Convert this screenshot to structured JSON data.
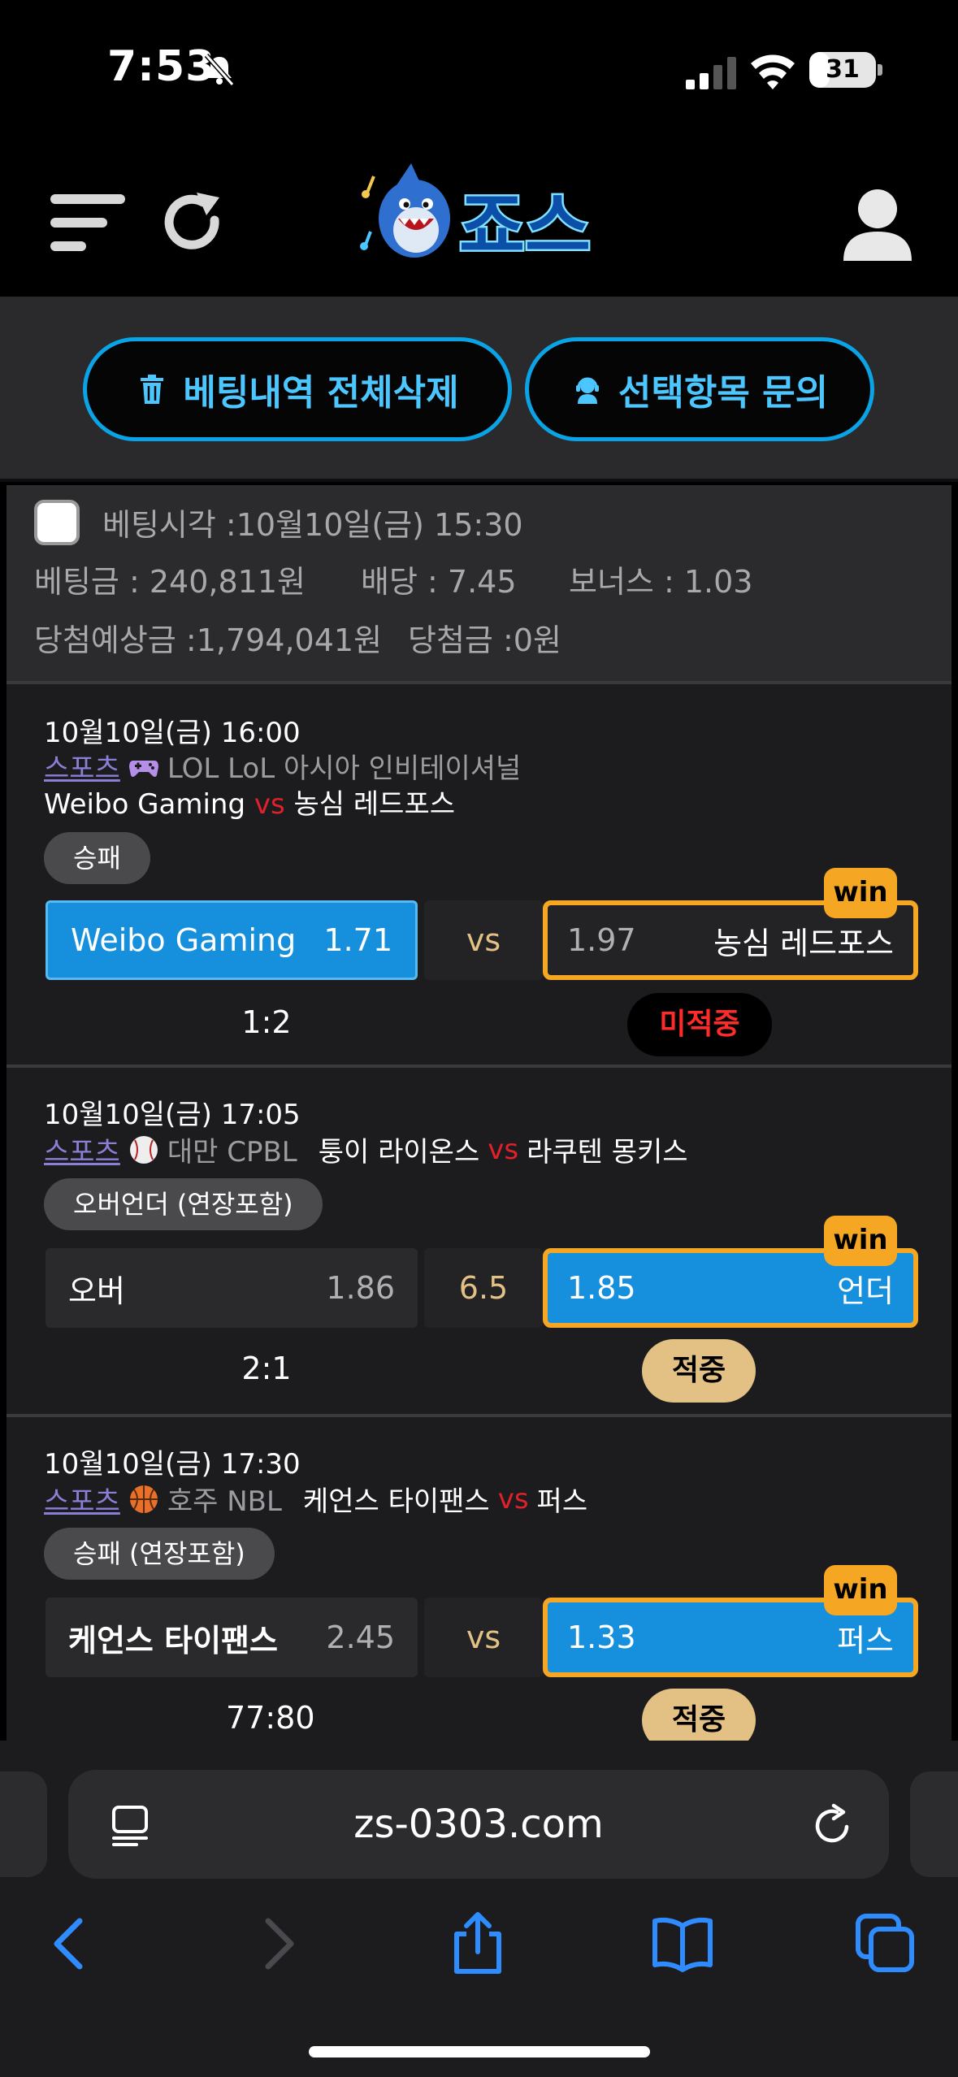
{
  "status_bar": {
    "time": "7:53",
    "battery": "31",
    "battery_level": 0.31
  },
  "header": {
    "logo_text": "죠스"
  },
  "actions": {
    "delete_all": "베팅내역 전체삭제",
    "inquiry": "선택항목 문의"
  },
  "bet_summary": {
    "time_label": "베팅시각 :",
    "time_value": "10월10일(금) 15:30",
    "stake_label": "베팅금 :",
    "stake_value": "240,811원",
    "odds_label": "배당 :",
    "odds_value": "7.45",
    "bonus_label": "보너스 :",
    "bonus_value": "1.03",
    "expected_label": "당첨예상금 :",
    "expected_value": "1,794,041원",
    "win_label": "당첨금 :",
    "win_value": "0원"
  },
  "matches": [
    {
      "time": "10월10일(금) 16:00",
      "sport": "스포츠",
      "league": "LOL LoL 아시아 인비테이셔널",
      "home": "Weibo Gaming",
      "vs": "vs",
      "away": "농심 레드포스",
      "market": "승패",
      "left_label": "Weibo Gaming",
      "left_odd": "1.71",
      "mid": "vs",
      "right_odd": "1.97",
      "right_label": "농심 레드포스",
      "win_badge": "win",
      "score": "1:2",
      "result": "미적중"
    },
    {
      "time": "10월10일(금) 17:05",
      "sport": "스포츠",
      "league": "대만 CPBL",
      "home": "퉁이 라이온스",
      "vs": "vs",
      "away": "라쿠텐 몽키스",
      "market": "오버언더 (연장포함)",
      "left_label": "오버",
      "left_odd": "1.86",
      "mid": "6.5",
      "right_odd": "1.85",
      "right_label": "언더",
      "win_badge": "win",
      "score": "2:1",
      "result": "적중"
    },
    {
      "time": "10월10일(금) 17:30",
      "sport": "스포츠",
      "league": "호주 NBL",
      "home": "케언스 타이팬스",
      "vs": "vs",
      "away": "퍼스",
      "market": "승패 (연장포함)",
      "left_label": "케언스 타이팬스",
      "left_odd": "2.45",
      "mid": "vs",
      "right_odd": "1.33",
      "right_label": "퍼스",
      "win_badge": "win",
      "score": "77:80",
      "result": "적중"
    }
  ],
  "browser": {
    "url": "zs-0303.com"
  },
  "colors": {
    "accent": "#0aa3e6",
    "win": "#f5a623",
    "selected": "#1690dc",
    "hit": "#e3c184",
    "miss": "#ff2a2a"
  }
}
